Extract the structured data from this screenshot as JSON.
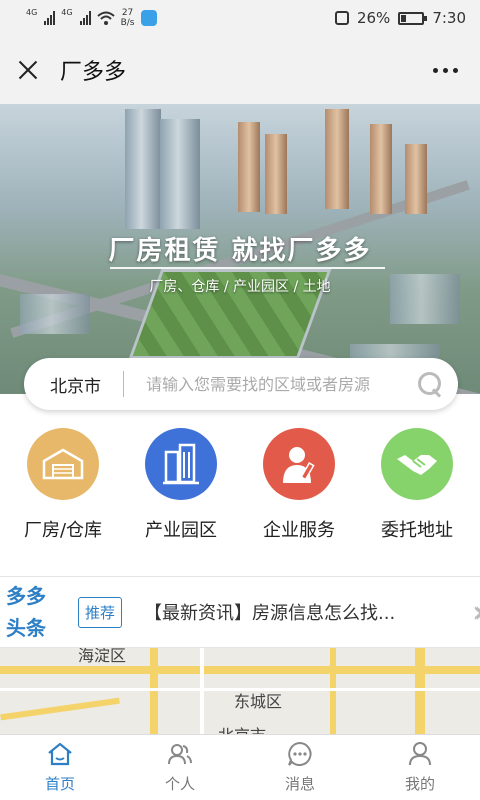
{
  "status_bar": {
    "signal1": "4G",
    "signal2": "4G",
    "speed_value": "27",
    "speed_unit": "B/s",
    "battery": "26%",
    "battery_level": 0.26,
    "time": "7:30"
  },
  "header": {
    "title": "厂多多"
  },
  "hero": {
    "title": "厂房租赁 就找厂多多",
    "subtitle": "厂房、仓库 / 产业园区 / 土地"
  },
  "search": {
    "city": "北京市",
    "placeholder": "请输入您需要找的区域或者房源"
  },
  "categories": [
    {
      "label": "厂房/仓库",
      "color": "#e8b86a",
      "icon": "warehouse-icon"
    },
    {
      "label": "产业园区",
      "color": "#3f72d9",
      "icon": "building-icon"
    },
    {
      "label": "企业服务",
      "color": "#e25b4a",
      "icon": "service-person-icon"
    },
    {
      "label": "委托地址",
      "color": "#86d36b",
      "icon": "handshake-icon"
    }
  ],
  "news": {
    "brand_line1": "多多",
    "brand_line2": "头条",
    "tag": "推荐",
    "text": "【最新资讯】房源信息怎么找..."
  },
  "map": {
    "district1": "海淀区",
    "district2": "东城区",
    "district3": "北京市"
  },
  "nav": [
    {
      "label": "首页",
      "icon": "home-icon",
      "active": true
    },
    {
      "label": "个人",
      "icon": "people-icon",
      "active": false
    },
    {
      "label": "消息",
      "icon": "chat-icon",
      "active": false
    },
    {
      "label": "我的",
      "icon": "user-icon",
      "active": false
    }
  ],
  "colors": {
    "accent": "#2d7fc6",
    "inactive": "#777777"
  }
}
